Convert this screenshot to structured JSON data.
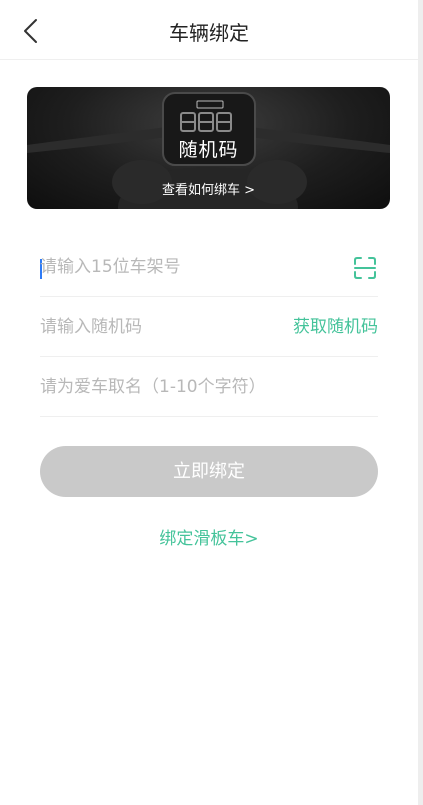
{
  "header": {
    "title": "车辆绑定",
    "back_icon": "chevron-left-icon"
  },
  "banner": {
    "title": "随机码",
    "link": "查看如何绑车 >",
    "icon": "scooter-display-illustration"
  },
  "form": {
    "frame_number_placeholder": "请输入15位车架号",
    "random_code_placeholder": "请输入随机码",
    "get_code_label": "获取随机码",
    "name_placeholder": "请为爱车取名（1-10个字符）",
    "scan_icon": "scan-icon"
  },
  "actions": {
    "submit_label": "立即绑定",
    "scooter_link": "绑定滑板车>"
  },
  "colors": {
    "accent": "#44c39a",
    "button_disabled": "#c9c9c9",
    "placeholder": "#b8b8b8"
  }
}
